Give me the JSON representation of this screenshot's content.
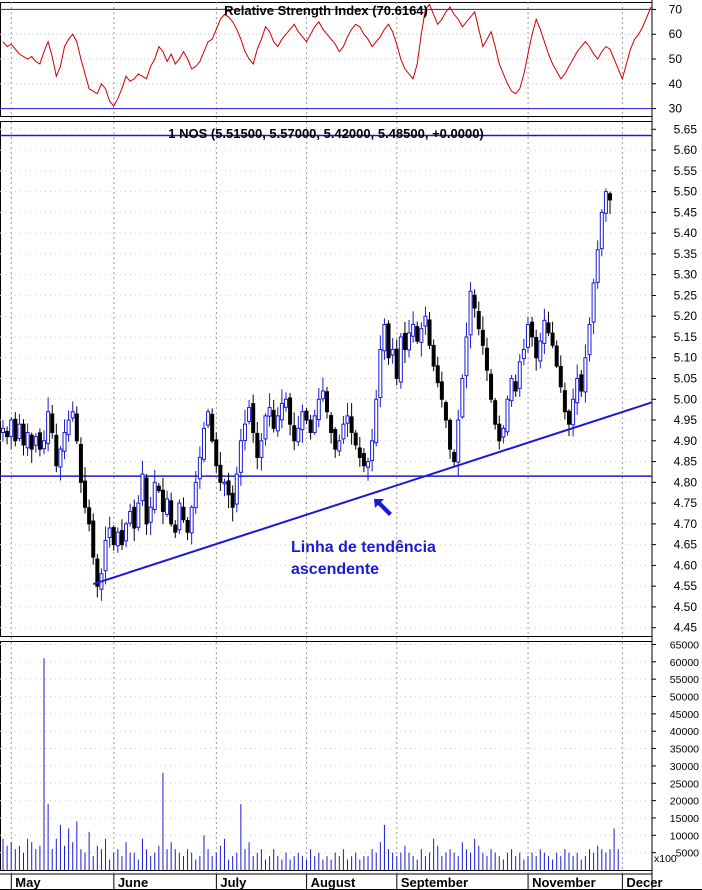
{
  "chart_data": [
    {
      "type": "line",
      "title": "Relative Strength Index (70.6164)",
      "ylim": [
        27,
        73
      ],
      "yticks": [
        30,
        40,
        50,
        60,
        70
      ],
      "reference_lines": [
        70,
        30
      ],
      "color": "#cc0000",
      "series": [
        {
          "values": [
            57,
            55,
            56,
            54,
            52,
            51,
            50,
            51,
            49,
            48,
            53,
            57,
            51,
            43,
            47,
            55,
            58,
            60,
            57,
            50,
            44,
            38,
            37,
            36,
            40,
            38,
            33,
            31,
            34,
            38,
            43,
            41,
            42,
            44,
            43,
            42,
            47,
            50,
            55,
            53,
            49,
            52,
            48,
            50,
            53,
            50,
            46,
            47,
            49,
            53,
            57,
            58,
            62,
            66,
            68,
            67,
            65,
            62,
            58,
            53,
            50,
            48,
            54,
            58,
            63,
            61,
            57,
            55,
            58,
            60,
            62,
            64,
            61,
            59,
            57,
            60,
            63,
            65,
            62,
            60,
            58,
            56,
            53,
            55,
            59,
            62,
            64,
            63,
            60,
            58,
            55,
            57,
            59,
            62,
            64,
            61,
            56,
            50,
            46,
            44,
            42,
            48,
            60,
            70,
            72,
            68,
            64,
            66,
            69,
            71,
            68,
            66,
            63,
            65,
            67,
            69,
            62,
            55,
            58,
            61,
            55,
            48,
            44,
            40,
            37,
            36,
            38,
            44,
            52,
            60,
            66,
            62,
            57,
            52,
            48,
            45,
            42,
            44,
            47,
            50,
            53,
            55,
            57,
            55,
            52,
            50,
            53,
            55,
            54,
            50,
            46,
            42,
            48,
            54,
            58,
            60,
            63,
            67,
            71
          ]
        }
      ]
    },
    {
      "type": "candlestick",
      "title": "1 NOS (5.51500, 5.57000, 5.42000, 5.48500, +0.0000)",
      "ylim": [
        4.43,
        5.67
      ],
      "yticks": [
        "4.45",
        "4.50",
        "4.55",
        "4.60",
        "4.65",
        "4.70",
        "4.75",
        "4.80",
        "4.85",
        "4.90",
        "4.95",
        "5.00",
        "5.05",
        "5.10",
        "5.15",
        "5.20",
        "5.25",
        "5.30",
        "5.35",
        "5.40",
        "5.45",
        "5.50",
        "5.55",
        "5.60",
        "5.65"
      ],
      "horizontal_lines": [
        5.635,
        4.815
      ],
      "trendline": {
        "from": {
          "i": 22,
          "price": 4.555
        },
        "to": {
          "i": 159,
          "price": 4.995
        }
      },
      "annotation": "Linha de tendência ascendente",
      "annotation_lines": [
        "Linha de tendência",
        "ascendente"
      ],
      "colors": {
        "up": "#1a1ad6",
        "down": "#000000",
        "lines": "#1a1ad6"
      },
      "closes": [
        4.93,
        4.91,
        4.95,
        4.9,
        4.94,
        4.89,
        4.92,
        4.88,
        4.91,
        4.88,
        4.9,
        4.97,
        4.92,
        4.84,
        4.88,
        4.92,
        4.95,
        4.97,
        4.9,
        4.8,
        4.74,
        4.7,
        4.62,
        4.55,
        4.58,
        4.66,
        4.69,
        4.65,
        4.68,
        4.65,
        4.7,
        4.73,
        4.69,
        4.75,
        4.82,
        4.7,
        4.74,
        4.8,
        4.78,
        4.73,
        4.76,
        4.7,
        4.68,
        4.75,
        4.71,
        4.68,
        4.74,
        4.8,
        4.86,
        4.93,
        4.97,
        4.9,
        4.84,
        4.8,
        4.8,
        4.77,
        4.74,
        4.82,
        4.9,
        4.94,
        4.98,
        4.92,
        4.86,
        4.9,
        4.96,
        4.98,
        4.93,
        4.96,
        4.99,
        5.0,
        4.94,
        4.9,
        4.93,
        4.97,
        4.95,
        4.92,
        4.96,
        5.0,
        5.02,
        4.97,
        4.92,
        4.88,
        4.9,
        4.94,
        4.96,
        4.92,
        4.89,
        4.86,
        4.84,
        4.85,
        4.9,
        5.0,
        5.12,
        5.18,
        5.1,
        5.12,
        5.05,
        5.15,
        5.12,
        5.16,
        5.18,
        5.14,
        5.17,
        5.2,
        5.13,
        5.08,
        5.04,
        5.0,
        4.95,
        4.88,
        4.85,
        4.95,
        5.05,
        5.15,
        5.26,
        5.22,
        5.17,
        5.13,
        5.07,
        5.0,
        4.94,
        4.9,
        4.93,
        5.0,
        5.05,
        5.02,
        5.09,
        5.12,
        5.18,
        5.15,
        5.1,
        5.14,
        5.19,
        5.16,
        5.13,
        5.08,
        5.03,
        4.97,
        4.94,
        5.0,
        5.05,
        5.02,
        5.1,
        5.18,
        5.28,
        5.36,
        5.45,
        5.5,
        5.48
      ]
    },
    {
      "type": "bar",
      "ylim": [
        0,
        66000
      ],
      "yticks": [
        "5000",
        "10000",
        "15000",
        "20000",
        "25000",
        "30000",
        "35000",
        "40000",
        "45000",
        "50000",
        "55000",
        "60000",
        "65000"
      ],
      "scale_label": "x100",
      "color": "#1a1ad6",
      "values": [
        9000,
        7000,
        8000,
        6000,
        7000,
        5000,
        9000,
        8000,
        6000,
        7000,
        61000,
        19000,
        6000,
        9000,
        13000,
        7000,
        12000,
        8000,
        14000,
        6000,
        5000,
        11000,
        4000,
        7000,
        6000,
        9000,
        3000,
        5000,
        6000,
        4000,
        8000,
        5000,
        5000,
        3000,
        9000,
        6000,
        4000,
        5000,
        7000,
        28000,
        6000,
        8000,
        6000,
        5000,
        4000,
        6000,
        5000,
        3000,
        4000,
        10000,
        6000,
        4000,
        5000,
        7000,
        9000,
        3000,
        4000,
        5000,
        19000,
        6000,
        8000,
        4000,
        5000,
        6000,
        3000,
        4000,
        6000,
        4000,
        3000,
        5000,
        3000,
        4000,
        5000,
        4000,
        3000,
        6000,
        4000,
        5000,
        3000,
        4000,
        3000,
        5000,
        4000,
        6000,
        3000,
        4000,
        5000,
        3000,
        4000,
        4000,
        6000,
        5000,
        8000,
        13000,
        6000,
        5000,
        4000,
        5000,
        7000,
        5000,
        4000,
        3000,
        6000,
        4000,
        5000,
        9000,
        7000,
        4000,
        5000,
        6000,
        5000,
        4000,
        8000,
        6000,
        5000,
        9000,
        7000,
        5000,
        4000,
        6000,
        5000,
        4000,
        3000,
        5000,
        6000,
        4000,
        5000,
        3000,
        4000,
        5000,
        4000,
        6000,
        5000,
        4000,
        3000,
        5000,
        4000,
        6000,
        5000,
        4000,
        5000,
        3000,
        4000,
        6000,
        5000,
        7000,
        6000,
        5000,
        6000,
        12000,
        6000
      ]
    }
  ],
  "months": [
    "May",
    "June",
    "July",
    "August",
    "September",
    "November",
    "Decer"
  ]
}
